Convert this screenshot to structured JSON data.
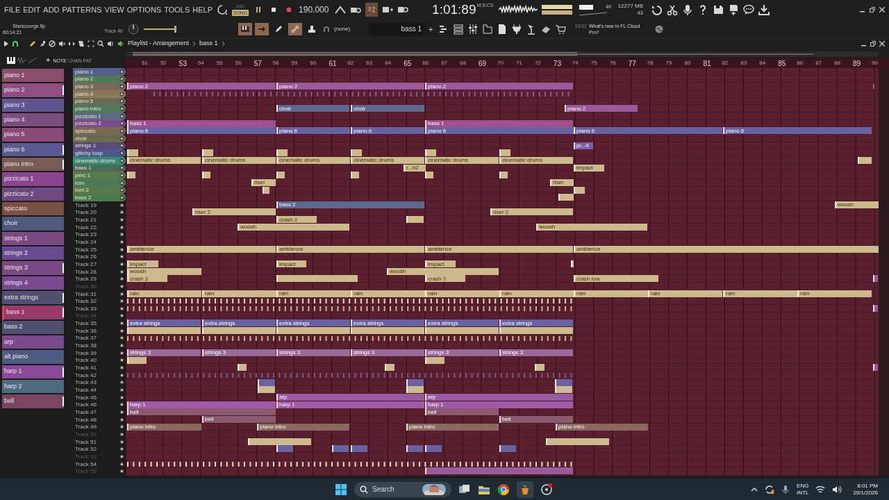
{
  "menu": [
    "FILE",
    "EDIT",
    "ADD",
    "PATTERNS",
    "VIEW",
    "OPTIONS",
    "TOOLS",
    "HELP"
  ],
  "mode": [
    {
      "label": "PAT",
      "selected": false
    },
    {
      "label": "SONG",
      "selected": true
    }
  ],
  "tempo": "190.000",
  "time": {
    "value": "1:01:89",
    "unit": "M:S:CS"
  },
  "cpu": {
    "polyphony": "40",
    "memory": "12277 MB",
    "voices": "43"
  },
  "project": {
    "file": "Starscourge.flp",
    "duration": "60:14:21",
    "hint": "Track 40"
  },
  "snap": "(none)",
  "master_pitch": {
    "level": 0.75
  },
  "current_pattern": "bass 1",
  "add_pattern": "+",
  "news": {
    "count": "10/12",
    "text": "What's new in FL Cloud Pro?"
  },
  "playlist": {
    "title": "Playlist - Arrangement",
    "pattern": "bass 1",
    "add_track": "+",
    "header_labels": [
      "NOTE",
      "CHAN",
      "PAT"
    ]
  },
  "ruler": [
    "51",
    "52",
    "53",
    "54",
    "55",
    "56",
    "57",
    "58",
    "59",
    "60",
    "61",
    "62",
    "63",
    "64",
    "65",
    "66",
    "67",
    "68",
    "69",
    "70",
    "71",
    "72",
    "73",
    "74",
    "75",
    "76",
    "77",
    "78",
    "79",
    "80",
    "81",
    "82",
    "83",
    "84",
    "85",
    "86",
    "87",
    "88",
    "89",
    "90"
  ],
  "patterns": [
    {
      "label": "piano 1",
      "color": "#8a4e6a",
      "marked": false,
      "selected": false
    },
    {
      "label": "piano 2",
      "color": "#8c4f80",
      "marked": true,
      "selected": false
    },
    {
      "label": "piano 3",
      "color": "#5f5690",
      "marked": false,
      "selected": false
    },
    {
      "label": "piano 4",
      "color": "#7a4f80",
      "marked": false,
      "selected": false
    },
    {
      "label": "piano 5",
      "color": "#8a4a78",
      "marked": false,
      "selected": false
    },
    {
      "label": "piano 6",
      "color": "#5a5a90",
      "marked": true,
      "selected": false
    },
    {
      "label": "piano intro",
      "color": "#7a5a55",
      "marked": true,
      "selected": false
    },
    {
      "label": "pizzicato 1",
      "color": "#8a4590",
      "marked": false,
      "selected": false
    },
    {
      "label": "pizzicato 2",
      "color": "#6e4a80",
      "marked": false,
      "selected": false
    },
    {
      "label": "spiccato",
      "color": "#7a5045",
      "marked": false,
      "selected": false
    },
    {
      "label": "choir",
      "color": "#4f5a7a",
      "marked": false,
      "selected": false
    },
    {
      "label": "strings 1",
      "color": "#7a4a80",
      "marked": false,
      "selected": false
    },
    {
      "label": "strings 2",
      "color": "#6a4a90",
      "marked": false,
      "selected": false
    },
    {
      "label": "strings 3",
      "color": "#7a4a85",
      "marked": true,
      "selected": false
    },
    {
      "label": "strings 4",
      "color": "#7a4a90",
      "marked": false,
      "selected": false
    },
    {
      "label": "extra strings",
      "color": "#4f4f70",
      "marked": true,
      "selected": false
    },
    {
      "label": "bass 1",
      "color": "#9a3a6a",
      "marked": true,
      "selected": true
    },
    {
      "label": "bass 2",
      "color": "#4f5070",
      "marked": false,
      "selected": false
    },
    {
      "label": "arp",
      "color": "#7a4a8a",
      "marked": false,
      "selected": false
    },
    {
      "label": "alt piano",
      "color": "#4f5a80",
      "marked": false,
      "selected": false
    },
    {
      "label": "harp 1",
      "color": "#8a4a95",
      "marked": true,
      "selected": false
    },
    {
      "label": "harp 2",
      "color": "#4f6a80",
      "marked": false,
      "selected": false
    },
    {
      "label": "bell",
      "color": "#7a4560",
      "marked": true,
      "selected": false
    }
  ],
  "tracks": [
    {
      "name": "piano 1",
      "color": "#55608a",
      "empty": false
    },
    {
      "name": "piano 2",
      "color": "#4f7a55",
      "empty": false
    },
    {
      "name": "piano 3",
      "color": "#7a6a5a",
      "empty": false,
      "clips": [
        {
          "kind": "pattern",
          "label": "piano 2",
          "color": "#9a5a9a"
        },
        {
          "kind": "pattern",
          "label": "piano 2",
          "color": "#9a5a9a"
        },
        {
          "kind": "pattern",
          "label": "piano 2",
          "color": "#9a5a9a"
        },
        {
          "kind": "blips",
          "color": "#9a5a9a"
        }
      ]
    },
    {
      "name": "piano 4",
      "color": "#8a7a5a",
      "empty": false,
      "clips": [
        {
          "kind": "blips",
          "color": "#8a5a90"
        }
      ]
    },
    {
      "name": "piano 5",
      "color": "#6a6a55",
      "empty": false
    },
    {
      "name": "piano intro",
      "color": "#4a7a5a",
      "empty": false,
      "clips": [
        {
          "kind": "pattern",
          "label": "choir",
          "color": "#5f6890"
        },
        {
          "kind": "pattern",
          "label": "choir",
          "color": "#5f6890"
        },
        {
          "kind": "pattern",
          "label": "piano 2",
          "color": "#9a5a9a"
        }
      ]
    },
    {
      "name": "pizzicato 1",
      "color": "#5a6a80",
      "empty": false
    },
    {
      "name": "pizzicato 2",
      "color": "#7a4a8a",
      "empty": false,
      "clips": [
        {
          "kind": "pattern",
          "label": "bass 1",
          "color": "#a0508a"
        },
        {
          "kind": "pattern",
          "label": "bass 1",
          "color": "#a0508a"
        }
      ]
    },
    {
      "name": "spiccato",
      "color": "#7a6a55",
      "empty": false,
      "clips": [
        {
          "kind": "pattern",
          "label": "piano 6",
          "color": "#6a62a0"
        },
        {
          "kind": "pattern",
          "label": "piano 6",
          "color": "#6a62a0"
        },
        {
          "kind": "pattern",
          "label": "piano 6",
          "color": "#6a62a0"
        },
        {
          "kind": "pattern",
          "label": "piano 6",
          "color": "#6a62a0"
        },
        {
          "kind": "pattern",
          "label": "piano 6",
          "color": "#6a62a0"
        },
        {
          "kind": "pattern",
          "label": "piano 6",
          "color": "#6a62a0"
        }
      ]
    },
    {
      "name": "choir",
      "color": "#6a6a50",
      "empty": false
    },
    {
      "name": "strings 1",
      "color": "#5a4a7a",
      "empty": false,
      "clips": [
        {
          "kind": "pattern",
          "label": "pi...4",
          "color": "#7a62a8"
        }
      ]
    },
    {
      "name": "glitchy loop",
      "color": "#4a5a8a",
      "empty": false,
      "clips": [
        {
          "kind": "audio"
        },
        {
          "kind": "audio"
        },
        {
          "kind": "audio"
        },
        {
          "kind": "audio"
        },
        {
          "kind": "audio"
        },
        {
          "kind": "audio"
        }
      ]
    },
    {
      "name": "cinematic drums",
      "color": "#3a8a7a",
      "empty": false,
      "clips": [
        {
          "kind": "audio",
          "label": "cinematic drums"
        },
        {
          "kind": "audio",
          "label": "cinematic drums"
        },
        {
          "kind": "audio",
          "label": "cinematic drums"
        },
        {
          "kind": "audio",
          "label": "cinematic drums"
        },
        {
          "kind": "audio",
          "label": "cinematic drums"
        },
        {
          "kind": "audio",
          "label": "cinematic drums"
        },
        {
          "kind": "audio"
        }
      ]
    },
    {
      "name": "bass 1",
      "color": "#4a6a5a",
      "empty": false,
      "clips": [
        {
          "kind": "audio",
          "label": "r...h2"
        },
        {
          "kind": "audio",
          "label": "impact"
        }
      ]
    },
    {
      "name": "perc 1",
      "color": "#5a7a4a",
      "empty": false,
      "clips": [
        {
          "kind": "audio"
        },
        {
          "kind": "audio"
        },
        {
          "kind": "audio"
        },
        {
          "kind": "audio"
        },
        {
          "kind": "audio"
        },
        {
          "kind": "audio"
        }
      ]
    },
    {
      "name": "tom",
      "color": "#4a7a5a",
      "empty": false,
      "clips": [
        {
          "kind": "audio",
          "label": "riser"
        },
        {
          "kind": "audio",
          "label": "riser"
        }
      ]
    },
    {
      "name": "tom 2",
      "color": "#5a7a4a",
      "empty": false,
      "clips": [
        {
          "kind": "audio"
        },
        {
          "kind": "audio"
        }
      ]
    },
    {
      "name": "bass 2",
      "color": "#4a7a4a",
      "empty": false,
      "clips": [
        {
          "kind": "audio"
        }
      ]
    },
    {
      "name": "Track 19",
      "empty": false,
      "clips": [
        {
          "kind": "pattern",
          "label": "bass 2",
          "color": "#5f6890"
        },
        {
          "kind": "audio",
          "label": "woosh"
        }
      ]
    },
    {
      "name": "Track 20",
      "empty": false,
      "clips": [
        {
          "kind": "audio",
          "label": "riser 2"
        },
        {
          "kind": "audio",
          "label": "riser 2"
        }
      ]
    },
    {
      "name": "Track 21",
      "empty": false,
      "clips": [
        {
          "kind": "audio",
          "label": "crash 2"
        },
        {
          "kind": "audio"
        }
      ]
    },
    {
      "name": "Track 22",
      "empty": false,
      "clips": [
        {
          "kind": "audio",
          "label": "woosh"
        },
        {
          "kind": "audio",
          "label": "woosh"
        }
      ]
    },
    {
      "name": "Track 23",
      "empty": false
    },
    {
      "name": "Track 24",
      "empty": false
    },
    {
      "name": "Track 25",
      "empty": false,
      "clips": [
        {
          "kind": "audio",
          "label": "ambience"
        },
        {
          "kind": "audio",
          "label": "ambience"
        },
        {
          "kind": "audio",
          "label": "ambience"
        },
        {
          "kind": "audio",
          "label": "ambience"
        }
      ]
    },
    {
      "name": "Track 26",
      "empty": false
    },
    {
      "name": "Track 27",
      "empty": false,
      "clips": [
        {
          "kind": "audio",
          "label": "impact"
        },
        {
          "kind": "audio",
          "label": "impact"
        },
        {
          "kind": "audio",
          "label": "impact"
        },
        {
          "kind": "audio"
        }
      ]
    },
    {
      "name": "Track 28",
      "empty": false,
      "clips": [
        {
          "kind": "audio",
          "label": "woosh"
        },
        {
          "kind": "audio",
          "label": "woosh"
        }
      ]
    },
    {
      "name": "Track 29",
      "empty": false,
      "clips": [
        {
          "kind": "audio",
          "label": "crash 2"
        },
        {
          "kind": "audio"
        },
        {
          "kind": "audio",
          "label": "crash 2"
        },
        {
          "kind": "audio",
          "label": "crash low"
        },
        {
          "kind": "pattern",
          "color": "#9a5a9a"
        }
      ]
    },
    {
      "name": "Track 30",
      "empty": true
    },
    {
      "name": "Track 31",
      "empty": false,
      "clips": [
        {
          "kind": "audio",
          "label": "rain"
        },
        {
          "kind": "audio",
          "label": "rain"
        },
        {
          "kind": "audio",
          "label": "rain"
        },
        {
          "kind": "audio",
          "label": "rain"
        },
        {
          "kind": "audio",
          "label": "rain"
        },
        {
          "kind": "audio",
          "label": "rain"
        },
        {
          "kind": "audio",
          "label": "rain"
        },
        {
          "kind": "audio",
          "label": "rain"
        },
        {
          "kind": "audio",
          "label": "rain"
        },
        {
          "kind": "audio",
          "label": "rain"
        }
      ]
    },
    {
      "name": "Track 32",
      "empty": false,
      "clips": [
        {
          "kind": "blips",
          "color": "#e8dcc0"
        }
      ]
    },
    {
      "name": "Track 33",
      "empty": false,
      "clips": [
        {
          "kind": "blips",
          "color": "#c8b890"
        },
        {
          "kind": "pattern",
          "color": "#9a5a9a"
        }
      ]
    },
    {
      "name": "Track 34",
      "empty": true
    },
    {
      "name": "Track 35",
      "empty": false,
      "clips": [
        {
          "kind": "pattern",
          "label": "extra strings",
          "color": "#6a62a0"
        },
        {
          "kind": "pattern",
          "label": "extra strings",
          "color": "#6a62a0"
        },
        {
          "kind": "pattern",
          "label": "extra strings",
          "color": "#6a62a0"
        },
        {
          "kind": "pattern",
          "label": "extra strings",
          "color": "#6a62a0"
        },
        {
          "kind": "pattern",
          "label": "extra strings",
          "color": "#6a62a0"
        },
        {
          "kind": "pattern",
          "label": "extra strings",
          "color": "#6a62a0"
        }
      ]
    },
    {
      "name": "Track 36",
      "empty": false,
      "clips": [
        {
          "kind": "audio"
        },
        {
          "kind": "audio"
        },
        {
          "kind": "audio"
        },
        {
          "kind": "audio"
        },
        {
          "kind": "audio"
        },
        {
          "kind": "audio"
        }
      ]
    },
    {
      "name": "Track 37",
      "empty": false,
      "clips": [
        {
          "kind": "blips",
          "color": "#c8b890"
        }
      ]
    },
    {
      "name": "Track 38",
      "empty": false
    },
    {
      "name": "Track 39",
      "empty": false,
      "clips": [
        {
          "kind": "pattern",
          "label": "strings 3",
          "color": "#9a6a9a"
        },
        {
          "kind": "pattern",
          "label": "strings 3",
          "color": "#9a6a9a"
        },
        {
          "kind": "pattern",
          "label": "strings 3",
          "color": "#9a6a9a"
        },
        {
          "kind": "pattern",
          "label": "strings 3",
          "color": "#9a6a9a"
        },
        {
          "kind": "pattern",
          "label": "strings 3",
          "color": "#9a6a9a"
        },
        {
          "kind": "pattern",
          "label": "strings 3",
          "color": "#9a6a9a"
        }
      ]
    },
    {
      "name": "Track 40",
      "empty": false,
      "clips": [
        {
          "kind": "audio"
        },
        {
          "kind": "audio"
        }
      ]
    },
    {
      "name": "Track 41",
      "empty": false,
      "clips": [
        {
          "kind": "audio"
        },
        {
          "kind": "audio"
        },
        {
          "kind": "audio"
        },
        {
          "kind": "pattern",
          "color": "#9a5a9a"
        }
      ]
    },
    {
      "name": "Track 42",
      "empty": false,
      "clips": [
        {
          "kind": "blips",
          "color": "#7a5a8a"
        }
      ]
    },
    {
      "name": "Track 43",
      "empty": false,
      "clips": [
        {
          "kind": "pattern",
          "color": "#6a62a0"
        },
        {
          "kind": "pattern",
          "color": "#6a62a0"
        },
        {
          "kind": "pattern",
          "color": "#6a62a0"
        }
      ]
    },
    {
      "name": "Track 44",
      "empty": false,
      "clips": [
        {
          "kind": "audio"
        },
        {
          "kind": "audio"
        },
        {
          "kind": "audio"
        }
      ]
    },
    {
      "name": "Track 45",
      "empty": false,
      "clips": [
        {
          "kind": "pattern",
          "label": "arp",
          "color": "#9a5aa0"
        },
        {
          "kind": "pattern",
          "label": "arp",
          "color": "#9a5aa0"
        }
      ]
    },
    {
      "name": "Track 46",
      "empty": false,
      "clips": [
        {
          "kind": "pattern",
          "label": "harp 1",
          "color": "#a05aa8"
        },
        {
          "kind": "pattern",
          "label": "harp 1",
          "color": "#a05aa8"
        },
        {
          "kind": "pattern",
          "label": "harp 1",
          "color": "#a05aa8"
        }
      ]
    },
    {
      "name": "Track 47",
      "empty": false,
      "clips": [
        {
          "kind": "pattern",
          "label": "bell",
          "color": "#8a5a70"
        },
        {
          "kind": "pattern",
          "label": "bell",
          "color": "#8a5a70"
        }
      ]
    },
    {
      "name": "Track 48",
      "empty": false,
      "clips": [
        {
          "kind": "pattern",
          "label": "bell",
          "color": "#8a5a70"
        },
        {
          "kind": "pattern",
          "label": "bell",
          "color": "#8a5a70"
        }
      ]
    },
    {
      "name": "Track 49",
      "empty": false,
      "clips": [
        {
          "kind": "pattern",
          "label": "piano intro",
          "color": "#8a6a60"
        },
        {
          "kind": "pattern",
          "label": "piano intro",
          "color": "#8a6a60"
        },
        {
          "kind": "pattern",
          "label": "piano intro",
          "color": "#8a6a60"
        },
        {
          "kind": "pattern",
          "label": "piano intro",
          "color": "#8a6a60"
        }
      ]
    },
    {
      "name": "Track 50",
      "empty": true
    },
    {
      "name": "Track 51",
      "empty": false,
      "clips": [
        {
          "kind": "audio"
        },
        {
          "kind": "audio"
        }
      ]
    },
    {
      "name": "Track 52",
      "empty": false,
      "clips": [
        {
          "kind": "pattern",
          "color": "#6a62a0"
        },
        {
          "kind": "pattern",
          "color": "#6a62a0"
        },
        {
          "kind": "pattern",
          "color": "#6a62a0"
        },
        {
          "kind": "pattern",
          "color": "#6a62a0"
        },
        {
          "kind": "pattern",
          "color": "#6a62a0"
        },
        {
          "kind": "pattern",
          "color": "#6a62a0"
        }
      ]
    },
    {
      "name": "Track 53",
      "empty": true
    },
    {
      "name": "Track 54",
      "empty": false,
      "clips": [
        {
          "kind": "blips",
          "color": "#e8dcc0"
        }
      ]
    },
    {
      "name": "Track 55",
      "empty": true,
      "clips": [
        {
          "kind": "pattern",
          "color": "#9a5a9a"
        }
      ]
    }
  ],
  "taskbar": {
    "search": "Search",
    "language": [
      "ENG",
      "INTL"
    ],
    "time": "8:01 PM",
    "date": "29/1/2026"
  }
}
